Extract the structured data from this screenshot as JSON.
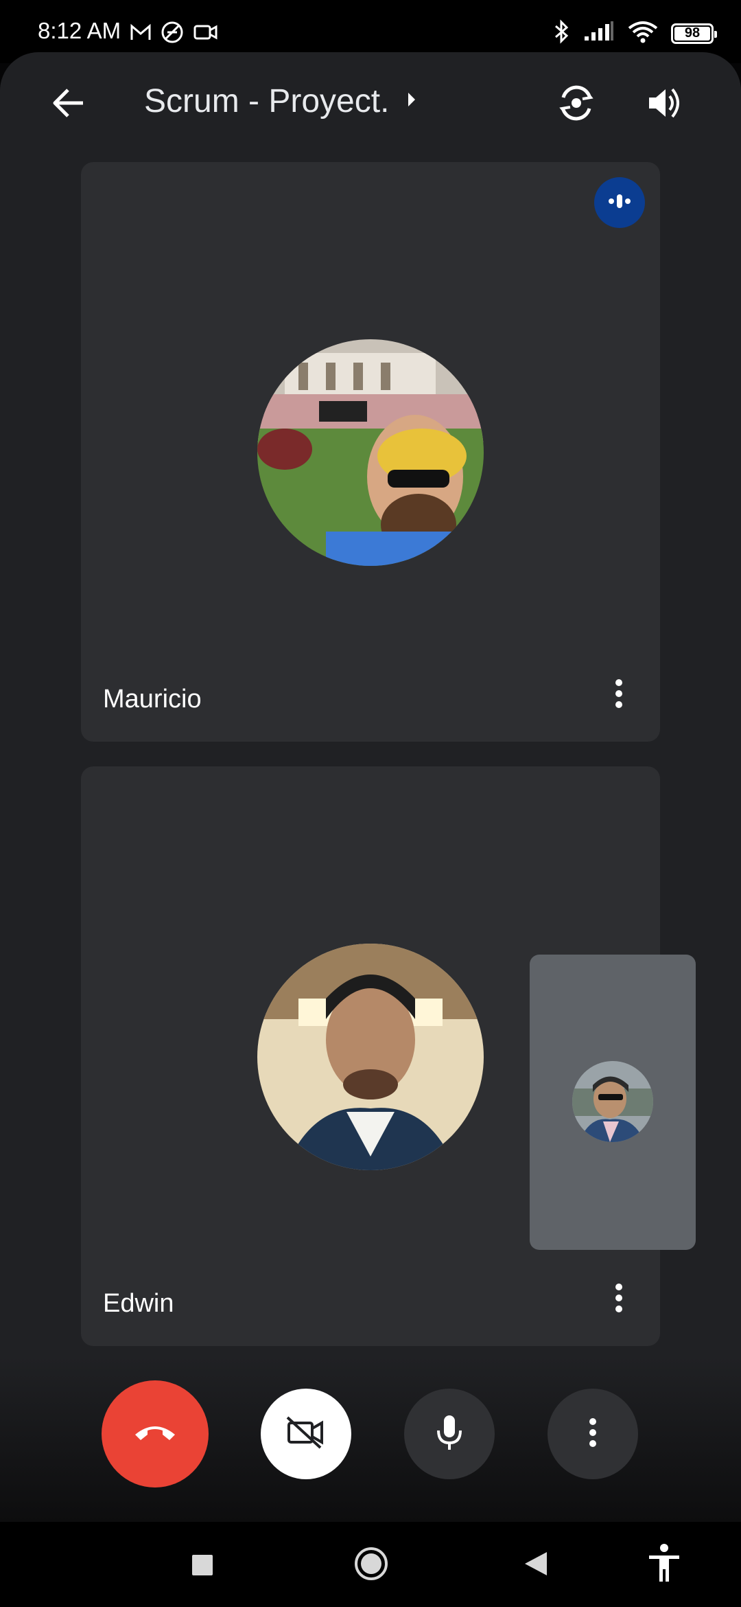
{
  "status_bar": {
    "time": "8:12 AM",
    "left_icons": [
      "gmail-icon",
      "dnd-off-icon",
      "video-camera-icon"
    ],
    "right_icons": [
      "bluetooth-icon",
      "signal-icon",
      "wifi-icon",
      "battery-icon"
    ],
    "battery_level": "98"
  },
  "header": {
    "title": "Scrum - Proyect.",
    "back_icon": "arrow-back-icon",
    "switch_camera_icon": "switch-camera-icon",
    "speaker_icon": "volume-up-icon"
  },
  "participants": [
    {
      "name": "Mauricio",
      "speaking": true
    },
    {
      "name": "Edwin",
      "speaking": false
    }
  ],
  "controls": {
    "end_call_icon": "call-end-icon",
    "camera_icon": "videocam-off-icon",
    "mic_icon": "mic-icon",
    "more_icon": "more-vert-icon"
  },
  "colors": {
    "end_call": "#ea4335",
    "speaking_indicator": "#0b3d91",
    "tile_bg": "#2d2e31",
    "self_view_bg": "#5f6368"
  }
}
